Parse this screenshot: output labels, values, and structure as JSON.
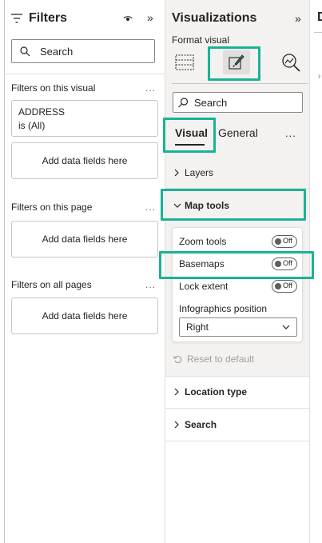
{
  "filters": {
    "title": "Filters",
    "search_placeholder": "Search",
    "on_visual_label": "Filters on this visual",
    "on_page_label": "Filters on this page",
    "on_all_pages_label": "Filters on all pages",
    "more": "...",
    "field_card": {
      "name": "ADDRESS",
      "condition": "is (All)"
    },
    "add_fields": "Add data fields here"
  },
  "visualizations": {
    "title": "Visualizations",
    "format_visual_label": "Format visual",
    "search_placeholder": "Search",
    "tabs": [
      {
        "label": "Visual",
        "active": true
      },
      {
        "label": "General",
        "active": false
      }
    ],
    "more": "...",
    "sections": {
      "layers": "Layers",
      "map_tools": "Map tools",
      "location_type": "Location type",
      "search": "Search"
    },
    "map_tools": {
      "zoom_tools": {
        "label": "Zoom tools",
        "state": "Off"
      },
      "basemaps": {
        "label": "Basemaps",
        "state": "Off"
      },
      "lock_extent": {
        "label": "Lock extent",
        "state": "Off"
      },
      "infographics_label": "Infographics position",
      "infographics_value": "Right"
    },
    "reset_label": "Reset to default"
  },
  "right_pane": {
    "letter": "D"
  },
  "colors": {
    "highlight": "#1ab394",
    "pane_bg": "#f3f2f1"
  }
}
